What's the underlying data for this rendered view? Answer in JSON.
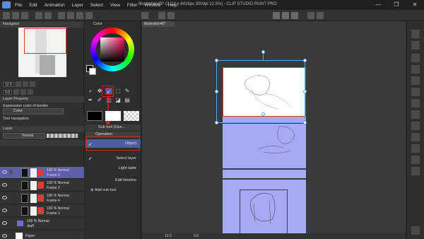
{
  "app": {
    "title": "Illustration45* (2112 x 8416px 300dpi 12.5%) - CLIP STUDIO PAINT PRO"
  },
  "menu": [
    "File",
    "Edit",
    "Animation",
    "Layer",
    "Select",
    "View",
    "Filter",
    "Window",
    "Help"
  ],
  "window_controls": [
    "—",
    "❐",
    "✕"
  ],
  "navigator": {
    "label": "Navigator",
    "zoom": "12.5",
    "angle": "0.0"
  },
  "color": {
    "label": "Color",
    "main": "#0b0b0b",
    "sub": "#ffffff"
  },
  "layer_property": {
    "label": "Layer Property",
    "expression_label": "Expression color of border",
    "expression_value": "Color"
  },
  "tool_navigation": {
    "label": "Tool navigation"
  },
  "layer_panel": {
    "label": "Layer",
    "blend_mode": "Normal",
    "opacity": "100",
    "layers": [
      {
        "percent": "100 % Normal",
        "name": "Frame 3",
        "selected": true
      },
      {
        "percent": "100 % Normal",
        "name": "Frame 2",
        "selected": false
      },
      {
        "percent": "100 % Normal",
        "name": "Frame 4",
        "selected": false
      },
      {
        "percent": "100 % Normal",
        "name": "Frame 1",
        "selected": false
      },
      {
        "percent": "100 % Normal",
        "name": "draft",
        "selected": false
      },
      {
        "percent": "",
        "name": "Paper",
        "selected": false
      }
    ]
  },
  "sub_tool": {
    "header": "Sub tool [Ope...",
    "group": "Operation",
    "items": [
      "Object",
      "Select layer",
      "Light table",
      "Edit timeline"
    ],
    "add_label": "Add sub tool"
  },
  "canvas": {
    "tab": "Illustration45*"
  },
  "status": {
    "zoom": "12.5",
    "angle": "0.0"
  },
  "colors": {
    "accent_red": "#e01e1e",
    "selection_blue": "#5fa4e8",
    "layer_select": "#5d5fae",
    "page_tint": "#a6a9f5"
  }
}
